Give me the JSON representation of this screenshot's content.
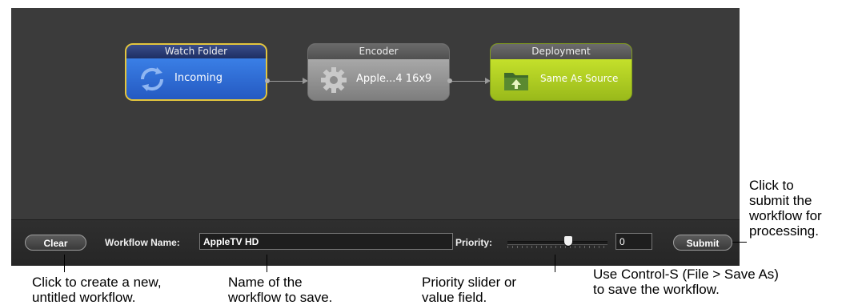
{
  "workflow": {
    "nodes": [
      {
        "title": "Watch Folder",
        "label": "Incoming"
      },
      {
        "title": "Encoder",
        "label": "Apple...4 16x9"
      },
      {
        "title": "Deployment",
        "label": "Same As Source"
      }
    ]
  },
  "bottom_bar": {
    "clear_label": "Clear",
    "workflow_name_label": "Workflow Name:",
    "workflow_name_value": "AppleTV HD",
    "priority_label": "Priority:",
    "priority_value": "0",
    "priority_level_percent": 62,
    "submit_label": "Submit"
  },
  "callouts": {
    "clear": [
      "Click to create a new,",
      "untitled workflow."
    ],
    "name": [
      "Name of the",
      "workflow to save."
    ],
    "priority": [
      "Priority slider or",
      "value field."
    ],
    "save": [
      "Use Control-S (File > Save As)",
      "to save the workflow."
    ],
    "submit": [
      "Click to",
      "submit the",
      "workflow for",
      "processing."
    ]
  },
  "colors": {
    "watch_folder": "#2f6fd8",
    "watch_folder_border": "#e3c53d",
    "encoder": "#8a8a8a",
    "deployment": "#a7c520"
  },
  "icons": {
    "watch_folder": "refresh-arrows-icon",
    "encoder": "gear-icon",
    "deployment": "folder-upload-icon"
  }
}
